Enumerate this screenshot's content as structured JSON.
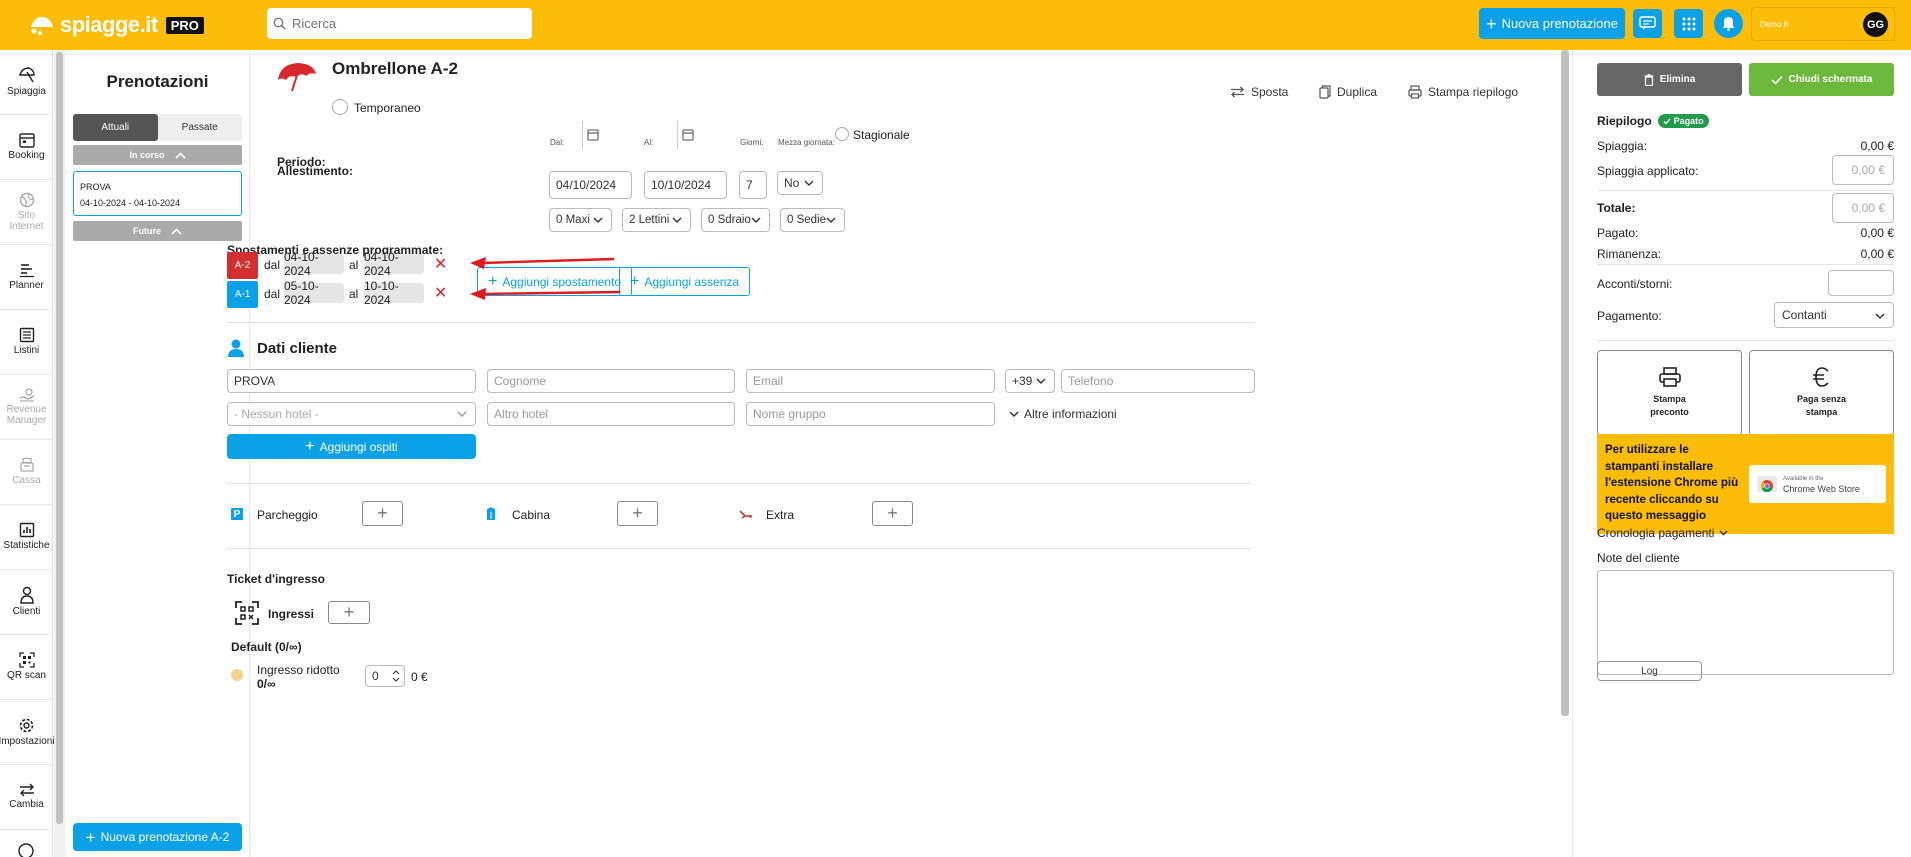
{
  "header": {
    "logo_text": "spiagge.it",
    "logo_badge": "PRO",
    "search_placeholder": "Ricerca",
    "new_booking": "Nuova prenotazione",
    "user_name": "Demo 8",
    "user_initials": "GG"
  },
  "nav": [
    {
      "label": "Spiaggia",
      "icon": "umbrella-icon",
      "disabled": false
    },
    {
      "label": "Booking",
      "icon": "calendar-icon",
      "disabled": false
    },
    {
      "label": "Sito Internet",
      "icon": "globe-icon",
      "disabled": true
    },
    {
      "label": "Planner",
      "icon": "planner-icon",
      "disabled": false
    },
    {
      "label": "Listini",
      "icon": "list-icon",
      "disabled": false
    },
    {
      "label": "Revenue Manager",
      "icon": "revenue-icon",
      "disabled": true
    },
    {
      "label": "Cassa",
      "icon": "register-icon",
      "disabled": true
    },
    {
      "label": "Statistiche",
      "icon": "chart-icon",
      "disabled": false
    },
    {
      "label": "Clienti",
      "icon": "user-icon",
      "disabled": false
    },
    {
      "label": "QR scan",
      "icon": "qr-icon",
      "disabled": false
    },
    {
      "label": "Impostazioni",
      "icon": "gear-icon",
      "disabled": false
    },
    {
      "label": "Cambia",
      "icon": "swap-icon",
      "disabled": false
    }
  ],
  "bookings": {
    "title": "Prenotazioni",
    "tab_current": "Attuali",
    "tab_past": "Passate",
    "section_current": "In corso",
    "card_name": "PROVA",
    "card_dates": "04-10-2024 - 04-10-2024",
    "section_future": "Future",
    "new_button": "Nuova prenotazione A-2"
  },
  "booking": {
    "title": "Ombrellone A-2",
    "temporary_label": "Temporaneo",
    "actions": {
      "move": "Sposta",
      "duplicate": "Duplica",
      "print": "Stampa riepilogo"
    },
    "period": {
      "label": "Periodo:",
      "from_label": "Dal:",
      "from": "04/10/2024",
      "to_label": "Al:",
      "to": "10/10/2024",
      "days_label": "Giorni:",
      "days": "7",
      "half_day_label": "Mezza giornata:",
      "half_day": "No",
      "seasonal": "Stagionale"
    },
    "setup": {
      "label": "Allestimento:",
      "maxi": "0 Maxi",
      "beds": "2 Lettini",
      "deckchairs": "0 Sdraio",
      "chairs": "0 Sedie"
    },
    "moves": {
      "label": "Spostamenti e assenze programmate:",
      "add_move": "Aggiungi spostamento",
      "add_absence": "Aggiungi assenza",
      "from_word": "dal",
      "to_word": "al",
      "rows": [
        {
          "spot": "A-2",
          "color": "#d32f2f",
          "from": "04-10-2024",
          "to": "04-10-2024"
        },
        {
          "spot": "A-1",
          "color": "#0aa1e8",
          "from": "05-10-2024",
          "to": "10-10-2024"
        }
      ]
    },
    "customer": {
      "title": "Dati cliente",
      "name": "PROVA",
      "surname_ph": "Cognome",
      "email_ph": "Email",
      "prefix": "+39",
      "phone_ph": "Telefono",
      "hotel_ph": "- Nessun hotel -",
      "other_hotel_ph": "Altro hotel",
      "group_ph": "Nome gruppo",
      "more_info": "Altre informazioni",
      "add_guests": "Aggiungi ospiti"
    },
    "extras": {
      "parking": "Parcheggio",
      "cabin": "Cabina",
      "extra": "Extra"
    },
    "tickets": {
      "title": "Ticket d'ingresso",
      "entries": "Ingressi",
      "default_label": "Default (0/∞)",
      "reduced_label": "Ingresso ridotto",
      "reduced_count": "0/∞",
      "reduced_qty": "0",
      "reduced_price": "0 €"
    }
  },
  "summary": {
    "delete": "Elimina",
    "close_screen": "Chiudi schermata",
    "title": "Riepilogo",
    "paid_badge": "Pagato",
    "beach_label": "Spiaggia:",
    "beach_value": "0,00 €",
    "applied_label": "Spiaggia applicato:",
    "applied_ph": "0,00 €",
    "total_label": "Totale:",
    "total_ph": "0,00 €",
    "paid_label": "Pagato:",
    "paid_value": "0,00 €",
    "remaining_label": "Rimanenza:",
    "remaining_value": "0,00 €",
    "deposits_label": "Acconti/storni:",
    "payment_label": "Pagamento:",
    "payment_value": "Contanti",
    "print_preaccount_1": "Stampa",
    "print_preaccount_2": "preconto",
    "pay_no_print_1": "Paga senza",
    "pay_no_print_2": "stampa",
    "promo_text": "Per utilizzare le stampanti installare l'estensione Chrome più recente cliccando su questo messaggio",
    "cws_small": "Available in the",
    "cws_big": "Chrome Web Store",
    "history": "Cronologia pagamenti",
    "notes_label": "Note del cliente",
    "log": "Log"
  },
  "colors": {
    "brand": "#fbbd08",
    "accent": "#0aa1e8",
    "danger": "#d32f2f",
    "success": "#6bb83a"
  }
}
